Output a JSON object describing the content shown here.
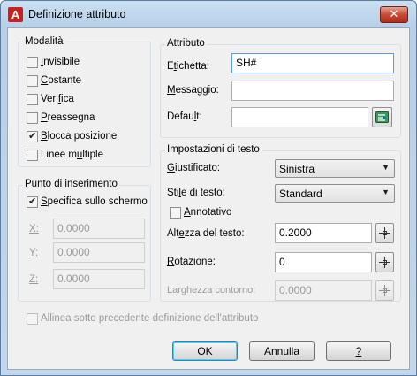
{
  "window": {
    "title": "Definizione attributo",
    "close_glyph": "✕"
  },
  "modalita": {
    "title": "Modalità",
    "options": [
      {
        "pre": "",
        "key": "I",
        "post": "nvisibile",
        "checked": false
      },
      {
        "pre": "",
        "key": "C",
        "post": "ostante",
        "checked": false
      },
      {
        "pre": "Veri",
        "key": "f",
        "post": "ica",
        "checked": false
      },
      {
        "pre": "",
        "key": "P",
        "post": "reassegna",
        "checked": false
      },
      {
        "pre": "",
        "key": "B",
        "post": "locca posizione",
        "checked": true
      },
      {
        "pre": "Linee m",
        "key": "u",
        "post": "ltiple",
        "checked": false
      }
    ]
  },
  "insertion": {
    "title": "Punto di inserimento",
    "specify": {
      "pre": "",
      "key": "S",
      "post": "pecifica sullo schermo",
      "checked": true
    },
    "x": {
      "label": "X:",
      "value": "0.0000"
    },
    "y": {
      "label": "Y:",
      "value": "0.0000"
    },
    "z": {
      "label": "Z:",
      "value": "0.0000"
    }
  },
  "attribute": {
    "title": "Attributo",
    "tag": {
      "pre": "E",
      "key": "t",
      "post": "ichetta:",
      "value": "SH#"
    },
    "prompt": {
      "pre": "",
      "key": "M",
      "post": "essaggio:",
      "value": ""
    },
    "default": {
      "pre": "Defau",
      "key": "l",
      "post": "t:",
      "value": ""
    }
  },
  "text_settings": {
    "title": "Impostazioni di testo",
    "justify": {
      "pre": "",
      "key": "G",
      "post": "iustificato:",
      "value": "Sinistra"
    },
    "style": {
      "pre": "Sti",
      "key": "l",
      "post": "e di testo:",
      "value": "Standard"
    },
    "annotative": {
      "pre": "",
      "key": "A",
      "post": "nnotativo",
      "checked": false
    },
    "height": {
      "pre": "Alt",
      "key": "e",
      "post": "zza del testo:",
      "value": "0.2000"
    },
    "rotation": {
      "pre": "",
      "key": "R",
      "post": "otazione:",
      "value": "0"
    },
    "boundary": {
      "label": "Larghezza contorno:",
      "value": "0.0000"
    }
  },
  "align_below": {
    "label": "Allinea sotto precedente definizione dell'attributo",
    "checked": false
  },
  "buttons": {
    "ok": "OK",
    "cancel": "Annulla",
    "help": "?"
  }
}
